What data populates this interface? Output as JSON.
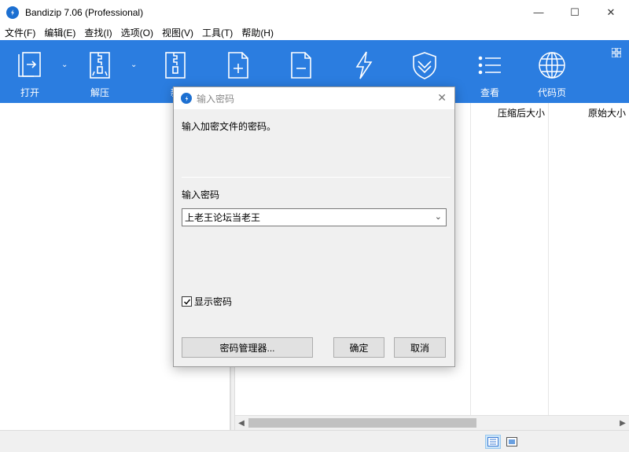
{
  "window": {
    "title": "Bandizip 7.06 (Professional)",
    "minimize_icon": "—",
    "maximize_icon": "☐",
    "close_icon": "✕"
  },
  "menu": [
    "文件(F)",
    "编辑(E)",
    "查找(I)",
    "选项(O)",
    "视图(V)",
    "工具(T)",
    "帮助(H)"
  ],
  "toolbar": {
    "accent": "#2b7de0",
    "buttons": [
      {
        "label": "打开",
        "icon": "open-icon"
      },
      {
        "label": "解压",
        "icon": "extract-icon"
      },
      {
        "label": "新",
        "icon": "new-archive-icon"
      },
      {
        "label": "",
        "icon": "add-file-icon"
      },
      {
        "label": "",
        "icon": "remove-file-icon"
      },
      {
        "label": "",
        "icon": "test-icon"
      },
      {
        "label": "",
        "icon": "shield-icon"
      },
      {
        "label": "查看",
        "icon": "view-list-icon"
      },
      {
        "label": "代码页",
        "icon": "globe-icon"
      }
    ]
  },
  "file_list": {
    "columns": [
      "压缩后大小",
      "原始大小"
    ]
  },
  "dialog": {
    "title": "输入密码",
    "description": "输入加密文件的密码。",
    "password_label": "输入密码",
    "password_value": "上老王论坛当老王",
    "show_password_label": "显示密码",
    "show_password_checked": true,
    "password_manager_button": "密码管理器...",
    "ok_button": "确定",
    "cancel_button": "取消"
  }
}
